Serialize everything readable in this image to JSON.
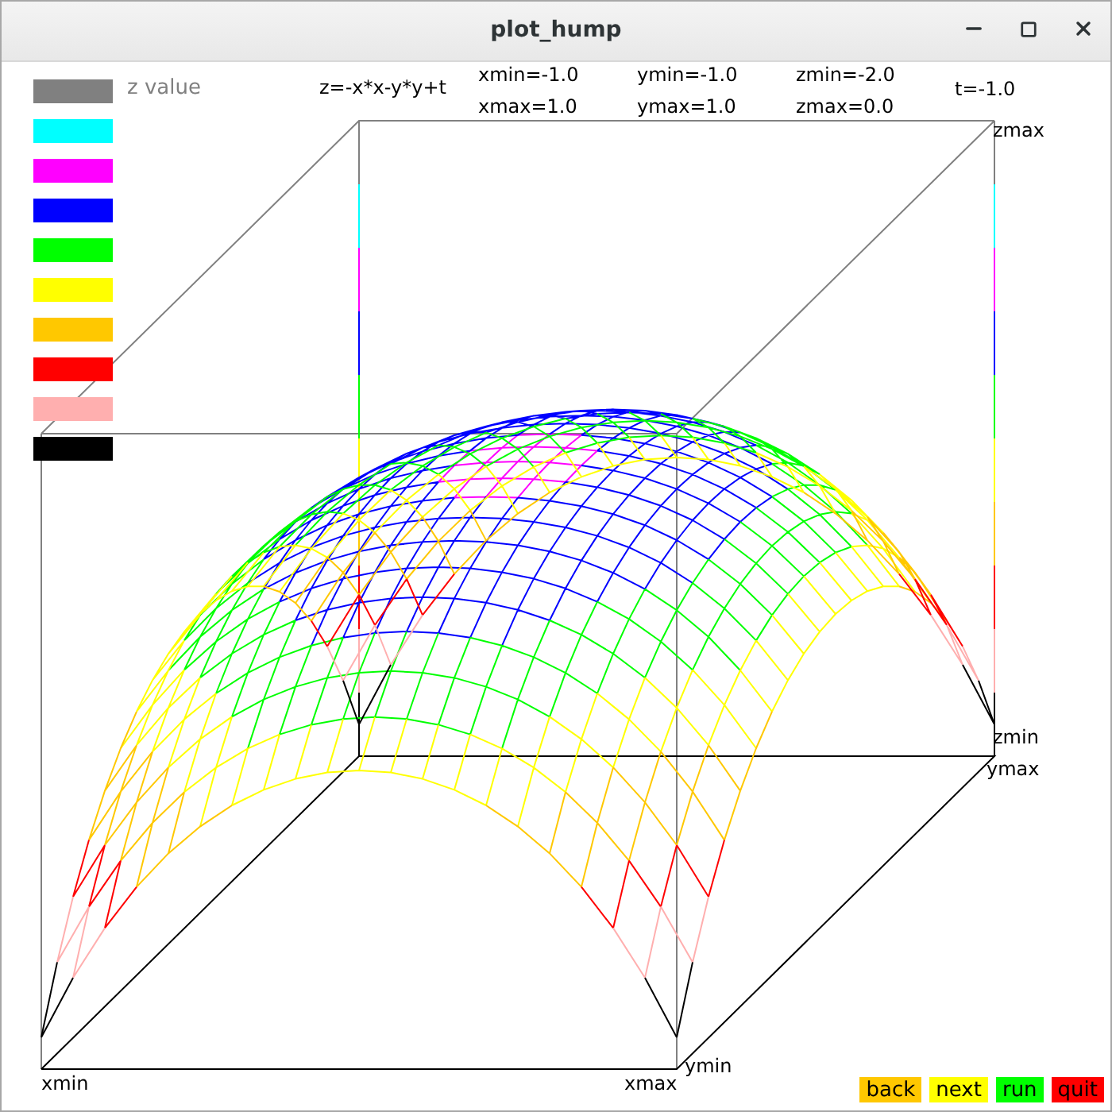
{
  "window": {
    "title": "plot_hump"
  },
  "legend": {
    "label": "z value",
    "swatches": [
      {
        "color": "#808080"
      },
      {
        "color": "#00ffff"
      },
      {
        "color": "#ff00ff"
      },
      {
        "color": "#0000ff"
      },
      {
        "color": "#00ff00"
      },
      {
        "color": "#ffff00"
      },
      {
        "color": "#ffc800"
      },
      {
        "color": "#ff0000"
      },
      {
        "color": "#ffafaf"
      },
      {
        "color": "#000000"
      }
    ]
  },
  "header": {
    "formula": "z=-x*x-y*y+t",
    "xmin": "xmin=-1.0",
    "xmax": "xmax=1.0",
    "ymin": "ymin=-1.0",
    "ymax": "ymax=1.0",
    "zmin": "zmin=-2.0",
    "zmax": "zmax=0.0",
    "t": "t=-1.0"
  },
  "axis_labels": {
    "xmin": "xmin",
    "xmax": "xmax",
    "ymin": "ymin",
    "ymax": "ymax",
    "zmin": "zmin",
    "zmax": "zmax"
  },
  "buttons": [
    {
      "label": "back",
      "color": "#ffc800"
    },
    {
      "label": "next",
      "color": "#ffff00"
    },
    {
      "label": "run",
      "color": "#00ff00"
    },
    {
      "label": "quit",
      "color": "#ff0000"
    }
  ]
}
